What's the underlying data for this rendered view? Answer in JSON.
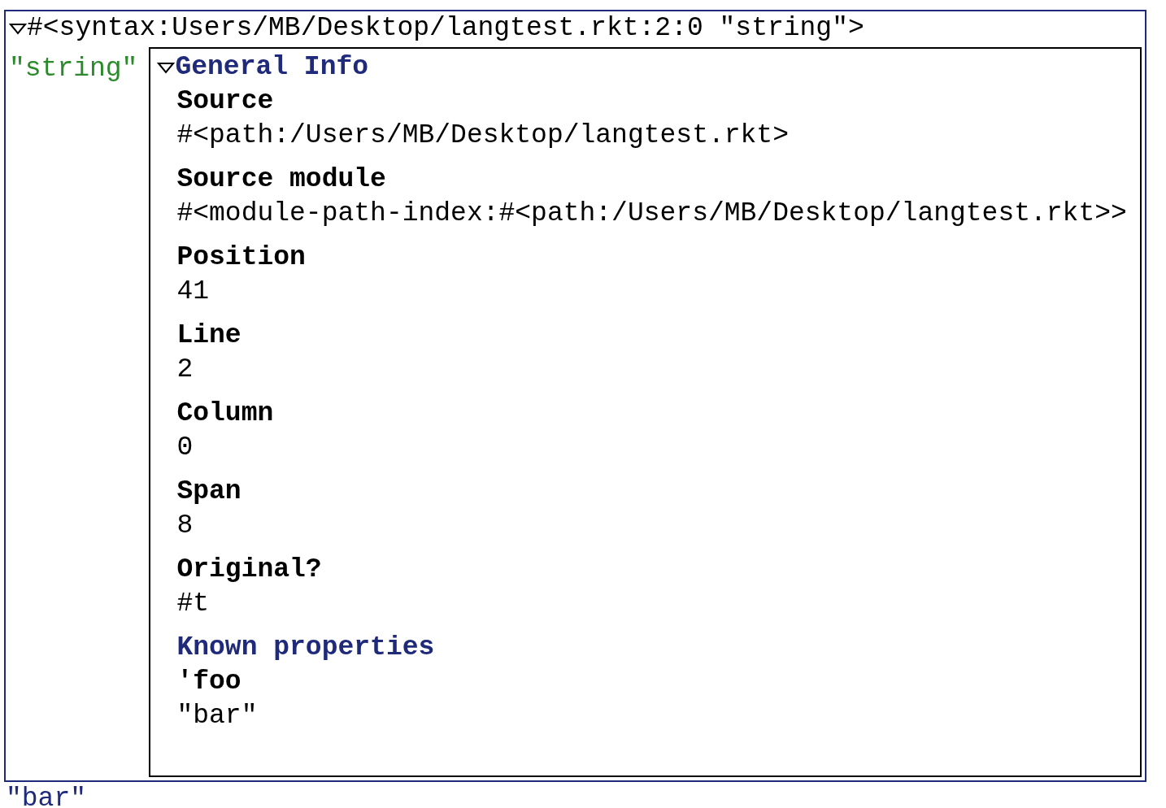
{
  "syntax_object": {
    "expanded": true,
    "header": "#<syntax:Users/MB/Desktop/langtest.rkt:2:0 \"string\">",
    "datum": "\"string\"",
    "general_info": {
      "title": "General Info",
      "expanded": true,
      "fields": [
        {
          "label": "Source",
          "value": "#<path:/Users/MB/Desktop/langtest.rkt>"
        },
        {
          "label": "Source module",
          "value": "#<module-path-index:#<path:/Users/MB/Desktop/langtest.rkt>>"
        },
        {
          "label": "Position",
          "value": "41"
        },
        {
          "label": "Line",
          "value": "2"
        },
        {
          "label": "Column",
          "value": "0"
        },
        {
          "label": "Span",
          "value": "8"
        },
        {
          "label": "Original?",
          "value": "#t"
        }
      ],
      "properties_heading": "Known properties",
      "properties": [
        {
          "key": "'foo",
          "value": "\"bar\""
        }
      ]
    }
  },
  "result": "\"bar\""
}
